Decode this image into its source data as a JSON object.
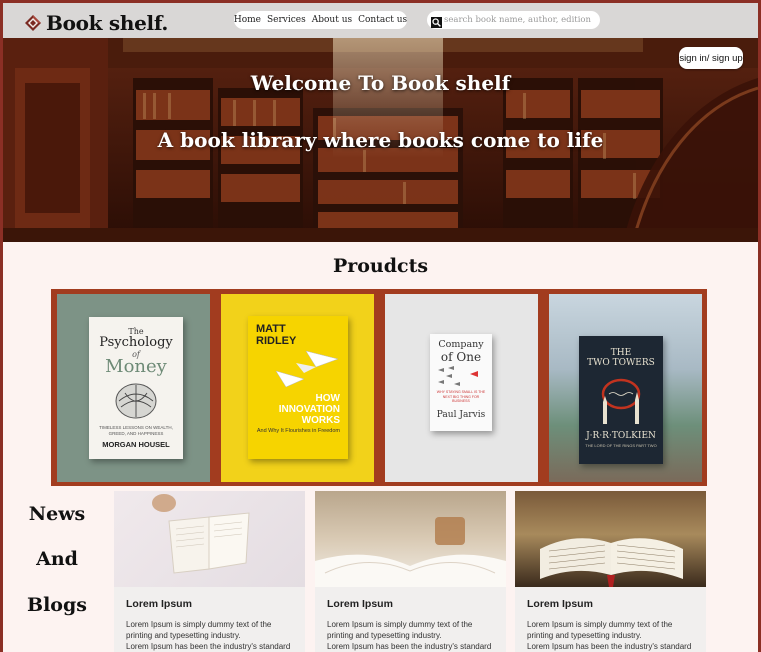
{
  "header": {
    "logo_text": "Book shelf.",
    "nav": [
      "Home",
      "Services",
      "About us",
      "Contact us"
    ],
    "search_placeholder": "search book name, author, edition"
  },
  "hero": {
    "title": "Welcome To Book shelf",
    "subtitle": "A book library where books come to life",
    "signin_label": "sign in/ sign up"
  },
  "products": {
    "heading": "Proudcts",
    "items": [
      {
        "title_line1": "The",
        "title_line2": "Psychology",
        "title_line3": "of",
        "title_line4": "Money",
        "tagline": "TIMELESS LESSONS ON WEALTH, GREED, AND HAPPINESS",
        "author": "MORGAN HOUSEL"
      },
      {
        "author_line1": "MATT",
        "author_line2": "RIDLEY",
        "title_line1": "HOW",
        "title_line2": "INNOVATION",
        "title_line3": "WORKS",
        "tagline": "And Why It Flourishes in Freedom"
      },
      {
        "title_line1": "Company",
        "title_line2": "of One",
        "tagline": "WHY STAYING SMALL IS THE NEXT BIG THING FOR BUSINESS",
        "author": "Paul Jarvis"
      },
      {
        "title_line1": "THE",
        "title_line2": "TWO TOWERS",
        "author": "J·R·R·TOLKIEN",
        "tagline": "THE LORD OF THE RINGS PART TWO"
      }
    ]
  },
  "news": {
    "words": [
      "News",
      "And",
      "Blogs"
    ],
    "cards": [
      {
        "title": "Lorem Ipsum",
        "text": "Lorem Ipsum is simply dummy text of the printing and typesetting industry.",
        "text2": "Lorem Ipsum has been the industry's standard"
      },
      {
        "title": "Lorem Ipsum",
        "text": "Lorem Ipsum is simply dummy text of the printing and typesetting industry.",
        "text2": "Lorem Ipsum has been the industry's standard"
      },
      {
        "title": "Lorem Ipsum",
        "text": "Lorem Ipsum is simply dummy text of the printing and typesetting industry.",
        "text2": "Lorem Ipsum has been the industry's standard"
      }
    ]
  },
  "colors": {
    "frame": "#8b2f25",
    "page_bg": "#fdf3f1",
    "header_bg": "#d9d7d6",
    "products_strip": "#a23c1f"
  }
}
